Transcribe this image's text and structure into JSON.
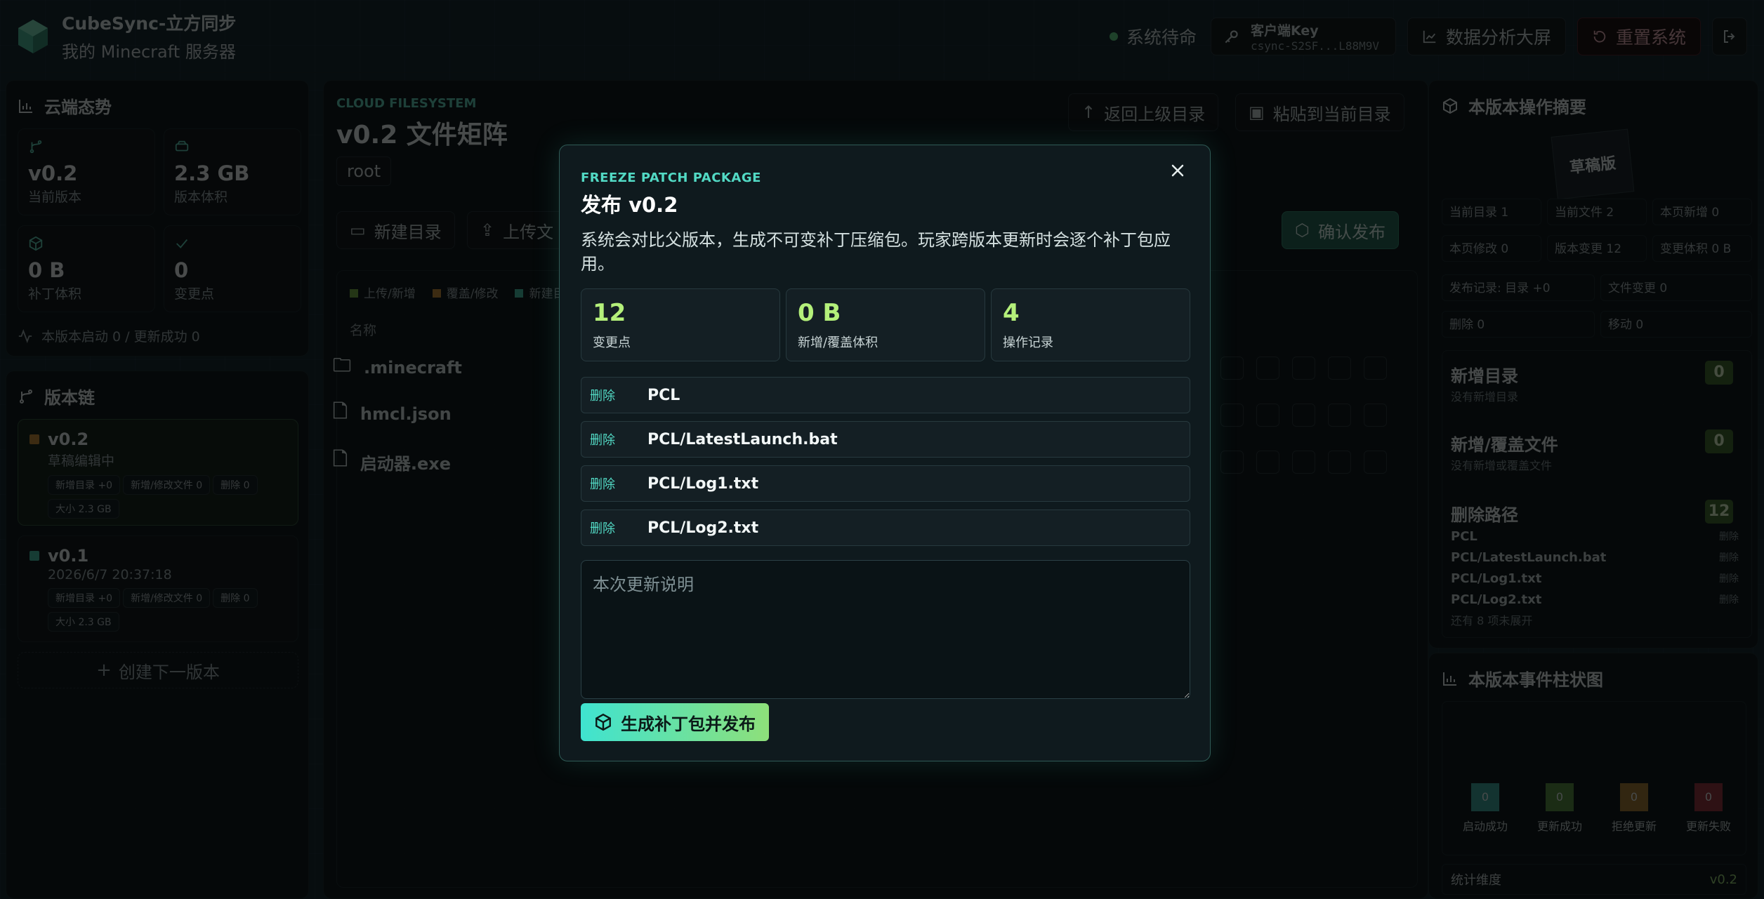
{
  "header": {
    "app_title": "CubeSync-立方同步",
    "server_name": "我的 Minecraft 服务器",
    "status": "系统待命",
    "key_label": "客户端Key",
    "key_value": "csync-S2SF...L88M9V",
    "analytics_button": "数据分析大屏",
    "reset_button": "重置系统"
  },
  "cloud_status": {
    "title": "云端态势",
    "cards": [
      {
        "value": "v0.2",
        "label": "当前版本"
      },
      {
        "value": "2.3 GB",
        "label": "版本体积"
      },
      {
        "value": "0 B",
        "label": "补丁体积"
      },
      {
        "value": "0",
        "label": "变更点"
      }
    ],
    "footer": "本版本启动 0 / 更新成功 0"
  },
  "version_chain": {
    "title": "版本链",
    "versions": [
      {
        "name": "v0.2",
        "sub": "草稿编辑中",
        "tags": [
          "新增目录 +0",
          "新增/修改文件 0",
          "删除 0",
          "大小 2.3 GB"
        ]
      },
      {
        "name": "v0.1",
        "sub": "2026/6/7 20:37:18",
        "tags": [
          "新增目录 +0",
          "新增/修改文件 0",
          "删除 0",
          "大小 2.3 GB"
        ]
      }
    ],
    "create_next": "创建下一版本"
  },
  "filesystem": {
    "kicker": "CLOUD FILESYSTEM",
    "title": "v0.2 文件矩阵",
    "path": "root",
    "back_button": "返回上级目录",
    "paste_button": "粘贴到当前目录",
    "new_dir_button": "新建目录",
    "upload_button": "上传文",
    "confirm_button": "确认发布",
    "legend": [
      "上传/新增",
      "覆盖/修改",
      "新建目"
    ],
    "col_name": "名称",
    "rows": [
      ".minecraft",
      "hmcl.json",
      "启动器.exe"
    ]
  },
  "summary": {
    "title": "本版本操作摘要",
    "draft_badge": "草稿版",
    "cells": [
      "当前目录 1",
      "当前文件 2",
      "本页新增 0",
      "本页修改 0",
      "版本变更 12",
      "变更体积 0 B",
      "发布记录: 目录 +0",
      "文件变更 0",
      "删除 0",
      "移动 0"
    ],
    "new_dirs": {
      "title": "新增目录",
      "count": "0",
      "empty": "没有新增目录"
    },
    "new_files": {
      "title": "新增/覆盖文件",
      "count": "0",
      "empty": "没有新增或覆盖文件"
    },
    "deleted": {
      "title": "删除路径",
      "count": "12",
      "items": [
        "PCL",
        "PCL/LatestLaunch.bat",
        "PCL/Log1.txt",
        "PCL/Log2.txt"
      ],
      "tag": "删除",
      "more": "还有 8 项未展开"
    }
  },
  "event_chart": {
    "title": "本版本事件柱状图",
    "bars": [
      {
        "label": "启动成功",
        "value": "0",
        "color": "#2fa79a"
      },
      {
        "label": "更新成功",
        "value": "0",
        "color": "#4f8f3a"
      },
      {
        "label": "拒绝更新",
        "value": "0",
        "color": "#a7782a"
      },
      {
        "label": "更新失败",
        "value": "0",
        "color": "#a0323e"
      }
    ],
    "footer_label": "统计维度",
    "footer_value": "v0.2"
  },
  "modal": {
    "kicker": "FREEZE PATCH PACKAGE",
    "title": "发布 v0.2",
    "description": "系统会对比父版本，生成不可变补丁压缩包。玩家跨版本更新时会逐个补丁包应用。",
    "stats": [
      {
        "value": "12",
        "label": "变更点"
      },
      {
        "value": "0 B",
        "label": "新增/覆盖体积"
      },
      {
        "value": "4",
        "label": "操作记录"
      }
    ],
    "operations": [
      {
        "kind": "删除",
        "path": "PCL"
      },
      {
        "kind": "删除",
        "path": "PCL/LatestLaunch.bat"
      },
      {
        "kind": "删除",
        "path": "PCL/Log1.txt"
      },
      {
        "kind": "删除",
        "path": "PCL/Log2.txt"
      }
    ],
    "notes_placeholder": "本次更新说明",
    "submit_button": "生成补丁包并发布"
  }
}
